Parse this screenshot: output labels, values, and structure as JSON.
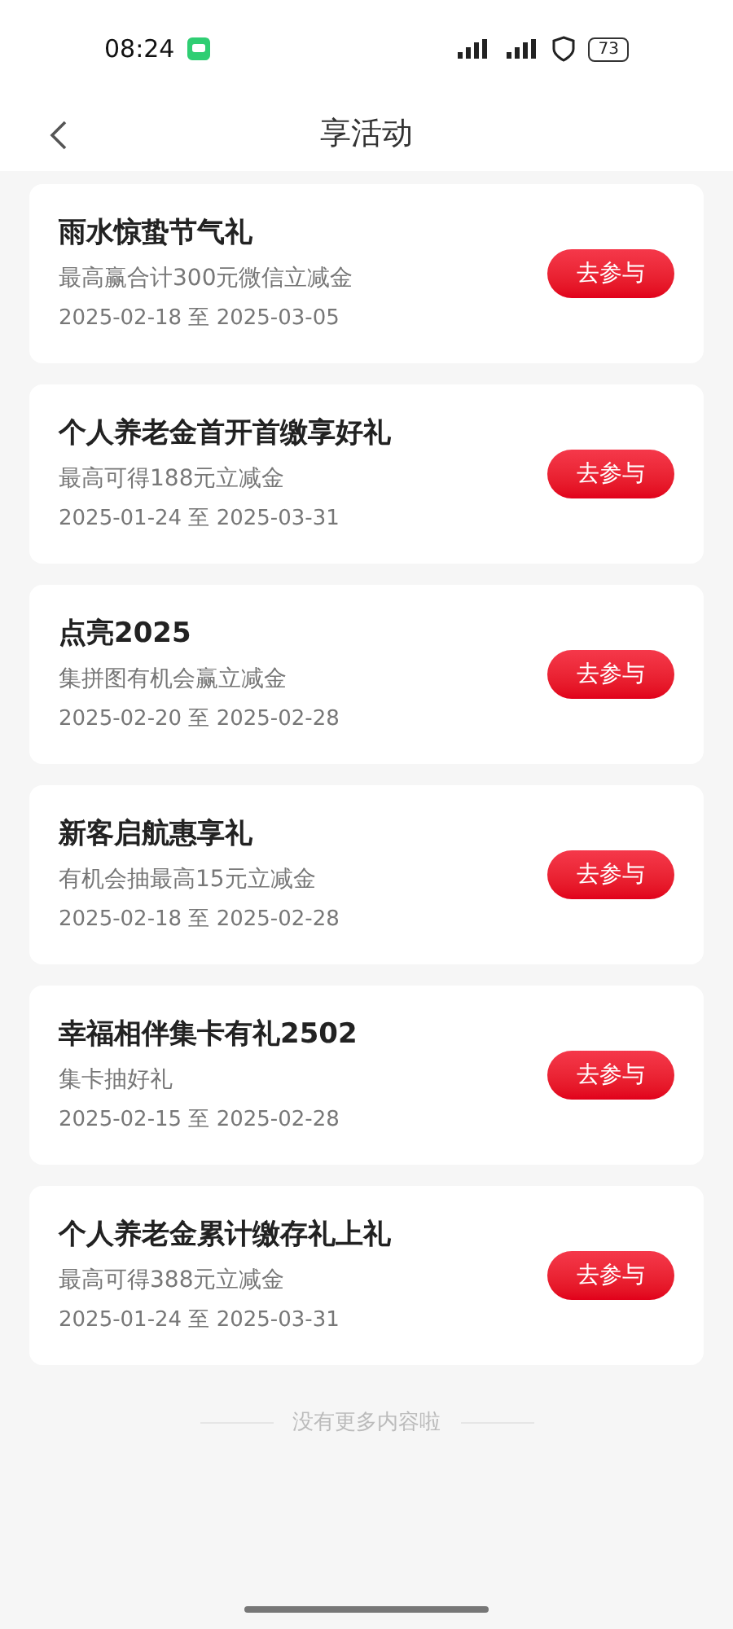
{
  "status_bar": {
    "time": "08:24",
    "battery": "73"
  },
  "header": {
    "title": "享活动"
  },
  "activities": [
    {
      "title": "雨水惊蛰节气礼",
      "subtitle": "最高赢合计300元微信立减金",
      "period": "2025-02-18 至 2025-03-05",
      "action": "去参与"
    },
    {
      "title": "个人养老金首开首缴享好礼",
      "subtitle": "最高可得188元立减金",
      "period": "2025-01-24 至 2025-03-31",
      "action": "去参与"
    },
    {
      "title": "点亮2025",
      "subtitle": "集拼图有机会赢立减金",
      "period": "2025-02-20 至 2025-02-28",
      "action": "去参与"
    },
    {
      "title": "新客启航惠享礼",
      "subtitle": "有机会抽最高15元立减金",
      "period": "2025-02-18 至 2025-02-28",
      "action": "去参与"
    },
    {
      "title": "幸福相伴集卡有礼2502",
      "subtitle": "集卡抽好礼",
      "period": "2025-02-15 至 2025-02-28",
      "action": "去参与"
    },
    {
      "title": "个人养老金累计缴存礼上礼",
      "subtitle": "最高可得388元立减金",
      "period": "2025-01-24 至 2025-03-31",
      "action": "去参与"
    }
  ],
  "footer": {
    "end_note": "没有更多内容啦"
  }
}
